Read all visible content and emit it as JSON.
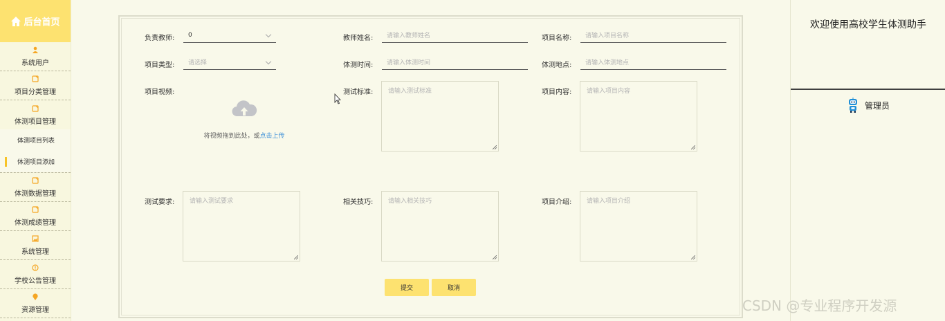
{
  "sidebar": {
    "title": "后台首页",
    "items": [
      {
        "label": "系统用户",
        "icon": "user-icon"
      },
      {
        "label": "项目分类管理",
        "icon": "folder-icon"
      },
      {
        "label": "体测项目管理",
        "icon": "folder-icon"
      },
      {
        "label": "体测数据管理",
        "icon": "folder-icon"
      },
      {
        "label": "体测成绩管理",
        "icon": "folder-icon"
      },
      {
        "label": "系统管理",
        "icon": "image-icon"
      },
      {
        "label": "学校公告管理",
        "icon": "alert-icon"
      },
      {
        "label": "资源管理",
        "icon": "location-icon"
      }
    ],
    "sub_items": [
      {
        "label": "体测项目列表",
        "active": false
      },
      {
        "label": "体测项目添加",
        "active": true
      }
    ]
  },
  "form": {
    "teacher": {
      "label": "负责教师:",
      "value": "0"
    },
    "teacher_name": {
      "label": "教师姓名:",
      "placeholder": "请输入教师姓名"
    },
    "project_name": {
      "label": "项目名称:",
      "placeholder": "请输入项目名称"
    },
    "project_type": {
      "label": "项目类型:",
      "placeholder": "请选择"
    },
    "test_time": {
      "label": "体测时间:",
      "placeholder": "请输入体测时间"
    },
    "test_place": {
      "label": "体测地点:",
      "placeholder": "请输入体测地点"
    },
    "project_video": {
      "label": "项目视频:",
      "upload_text": "将视频拖到此处，或",
      "upload_link": "点击上传"
    },
    "test_standard": {
      "label": "测试标准:",
      "placeholder": "请输入测试标准"
    },
    "project_content": {
      "label": "项目内容:",
      "placeholder": "请输入项目内容"
    },
    "test_requirement": {
      "label": "测试要求:",
      "placeholder": "请输入测试要求"
    },
    "related_skills": {
      "label": "相关技巧:",
      "placeholder": "请输入相关技巧"
    },
    "project_intro": {
      "label": "项目介绍:",
      "placeholder": "请输入项目介绍"
    },
    "submit_label": "提交",
    "cancel_label": "取消"
  },
  "right_panel": {
    "welcome": "欢迎使用高校学生体测助手",
    "user_role": "管理员"
  },
  "watermark": "CSDN @专业程序开发源",
  "colors": {
    "accent": "#fde270",
    "background": "#f9f9ea",
    "link": "#3c8fd8"
  }
}
